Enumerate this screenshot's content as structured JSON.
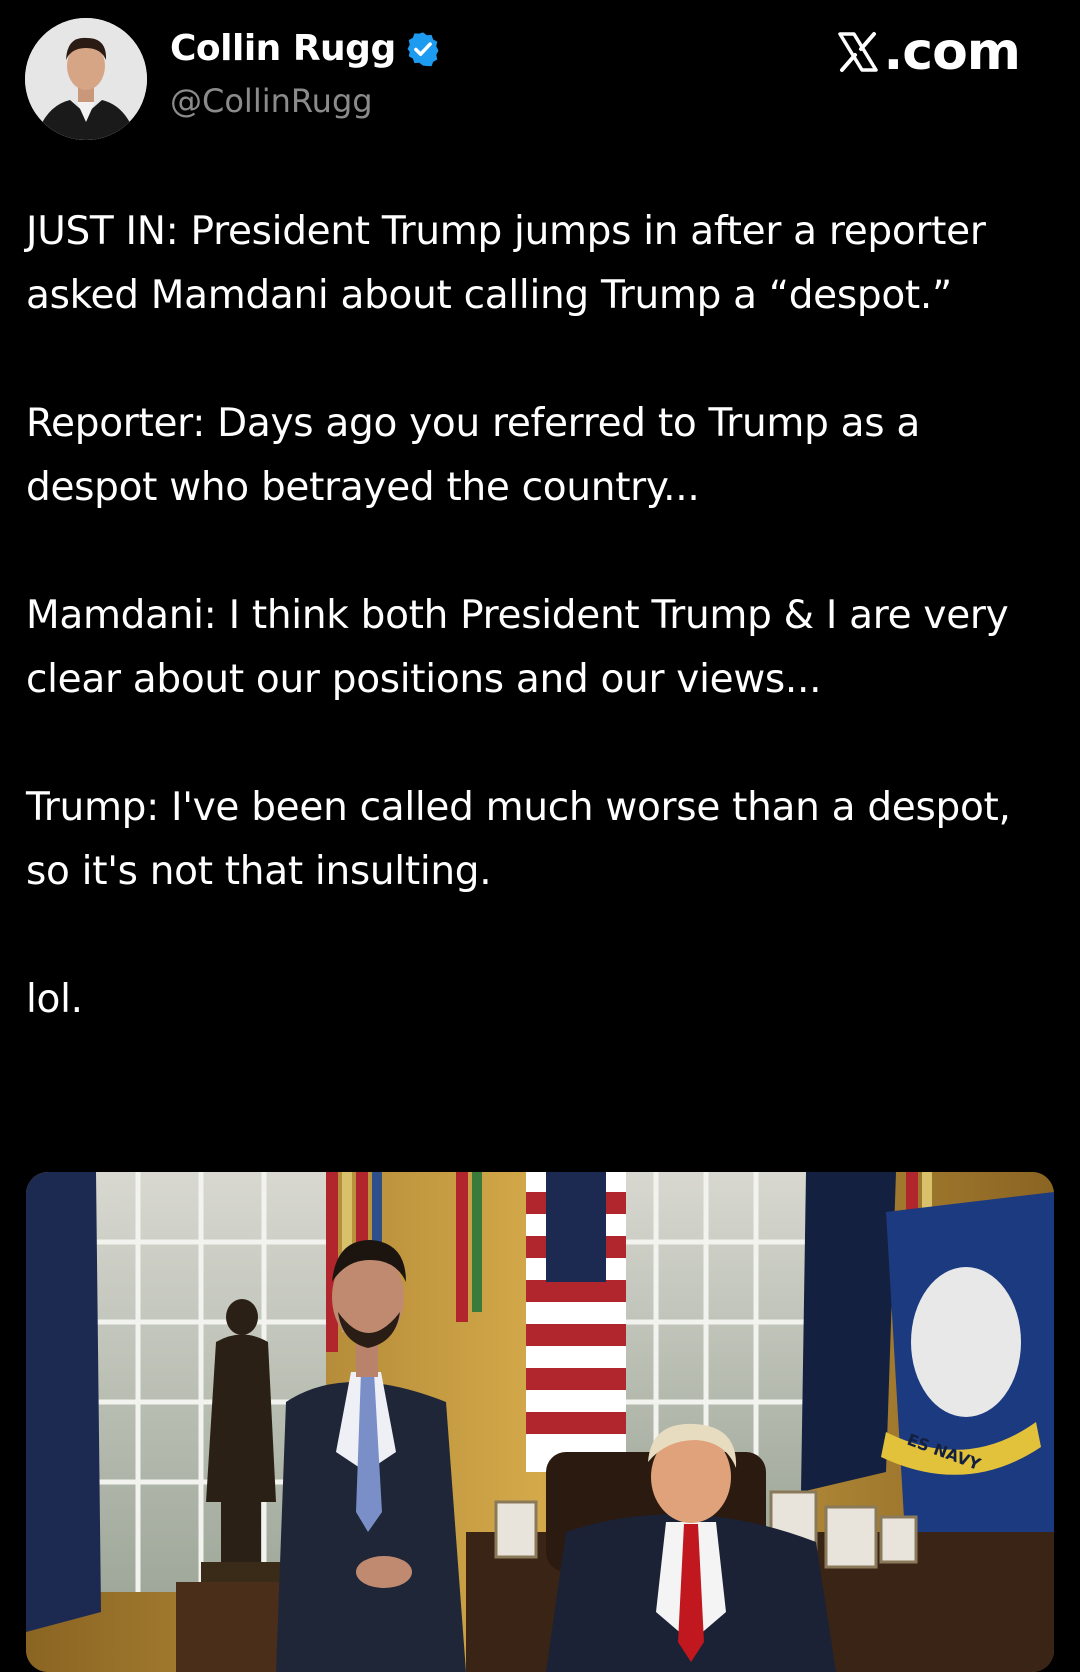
{
  "author": {
    "name": "Collin Rugg",
    "handle": "@CollinRugg",
    "verified": true,
    "verified_color": "#1d9bf0"
  },
  "site": {
    "logo_icon": "x-logo-icon",
    "label": ".com"
  },
  "tweet": {
    "paragraphs": [
      "JUST IN: President Trump jumps in after a reporter asked Mamdani about calling Trump a “despot.”",
      "Reporter: Days ago you referred to Trump as a despot who betrayed the country...",
      "Mamdani: I think both President Trump & I are very clear about our positions and our views...",
      "Trump: I've been called much worse than a despot, so it's not that insulting.",
      "lol."
    ]
  },
  "media": {
    "flag_text": "ES NAVY"
  },
  "colors": {
    "background": "#000000",
    "text": "#ffffff",
    "secondary_text": "#8b8b8b"
  }
}
